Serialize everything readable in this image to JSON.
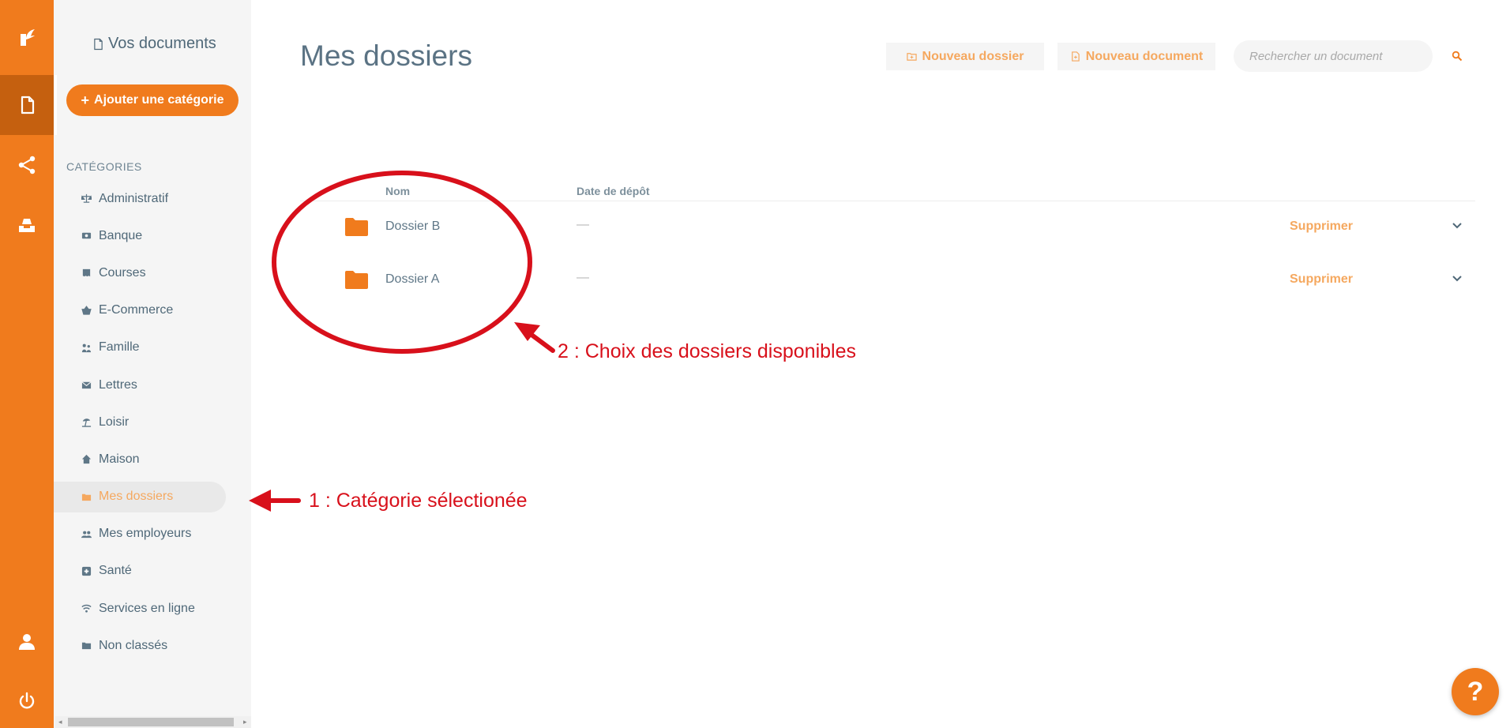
{
  "rail": {
    "items": [
      {
        "icon": "logo-icon"
      },
      {
        "icon": "document-icon",
        "active": true
      },
      {
        "icon": "share-icon"
      },
      {
        "icon": "inbox-tray-icon"
      },
      {
        "icon": "user-icon"
      },
      {
        "icon": "power-icon"
      }
    ]
  },
  "sidebar": {
    "title": "Vos documents",
    "add_category_label": "Ajouter une catégorie",
    "categories_heading": "CATÉGORIES",
    "categories": [
      {
        "label": "Administratif",
        "icon": "scale-icon"
      },
      {
        "label": "Banque",
        "icon": "money-icon"
      },
      {
        "label": "Courses",
        "icon": "receipt-icon"
      },
      {
        "label": "E-Commerce",
        "icon": "basket-icon"
      },
      {
        "label": "Famille",
        "icon": "family-icon"
      },
      {
        "label": "Lettres",
        "icon": "envelope-icon"
      },
      {
        "label": "Loisir",
        "icon": "beach-icon"
      },
      {
        "label": "Maison",
        "icon": "house-icon"
      },
      {
        "label": "Mes dossiers",
        "icon": "folder-icon",
        "selected": true
      },
      {
        "label": "Mes employeurs",
        "icon": "people-icon"
      },
      {
        "label": "Santé",
        "icon": "medical-plus-icon"
      },
      {
        "label": "Services en ligne",
        "icon": "wifi-icon"
      },
      {
        "label": "Non classés",
        "icon": "folder-icon"
      }
    ]
  },
  "main": {
    "title": "Mes dossiers",
    "new_folder_label": "Nouveau dossier",
    "new_document_label": "Nouveau document",
    "search_placeholder": "Rechercher un document",
    "columns": {
      "name": "Nom",
      "date": "Date de dépôt"
    },
    "rows": [
      {
        "name": "Dossier B",
        "date": "—",
        "delete_label": "Supprimer"
      },
      {
        "name": "Dossier A",
        "date": "—",
        "delete_label": "Supprimer"
      }
    ]
  },
  "annotations": {
    "folders_note": "2 : Choix des dossiers disponibles",
    "category_note": "1 : Catégorie sélectionée"
  },
  "help_label": "?",
  "colors": {
    "accent": "#f07b1d",
    "accent_dark": "#c5600f",
    "accent_light_text": "#f5a85f",
    "annotation_red": "#d8101b",
    "sidebar_bg": "#f5f5f5"
  }
}
